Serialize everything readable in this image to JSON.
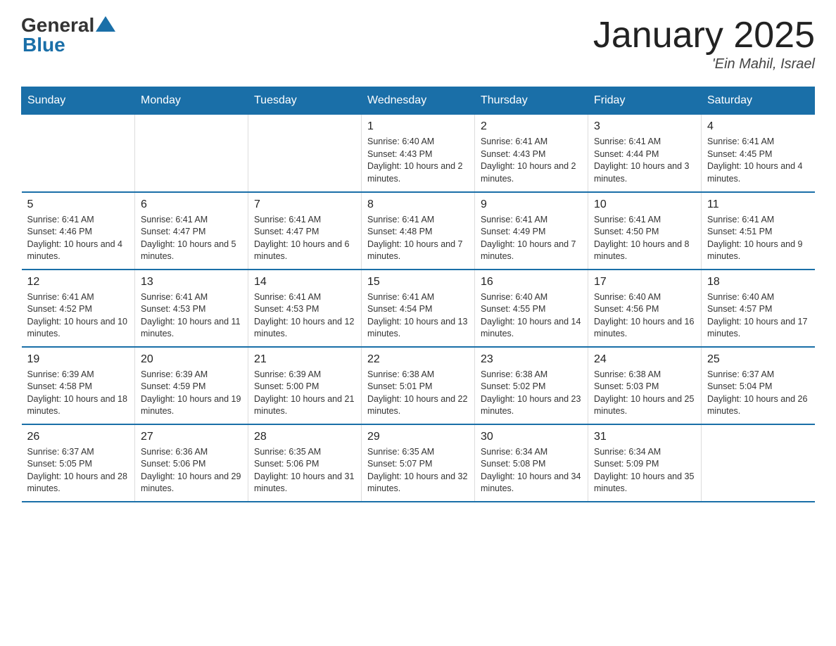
{
  "header": {
    "logo_general": "General",
    "logo_blue": "Blue",
    "title": "January 2025",
    "subtitle": "'Ein Mahil, Israel"
  },
  "days_of_week": [
    "Sunday",
    "Monday",
    "Tuesday",
    "Wednesday",
    "Thursday",
    "Friday",
    "Saturday"
  ],
  "weeks": [
    [
      {
        "day": "",
        "info": ""
      },
      {
        "day": "",
        "info": ""
      },
      {
        "day": "",
        "info": ""
      },
      {
        "day": "1",
        "info": "Sunrise: 6:40 AM\nSunset: 4:43 PM\nDaylight: 10 hours and 2 minutes."
      },
      {
        "day": "2",
        "info": "Sunrise: 6:41 AM\nSunset: 4:43 PM\nDaylight: 10 hours and 2 minutes."
      },
      {
        "day": "3",
        "info": "Sunrise: 6:41 AM\nSunset: 4:44 PM\nDaylight: 10 hours and 3 minutes."
      },
      {
        "day": "4",
        "info": "Sunrise: 6:41 AM\nSunset: 4:45 PM\nDaylight: 10 hours and 4 minutes."
      }
    ],
    [
      {
        "day": "5",
        "info": "Sunrise: 6:41 AM\nSunset: 4:46 PM\nDaylight: 10 hours and 4 minutes."
      },
      {
        "day": "6",
        "info": "Sunrise: 6:41 AM\nSunset: 4:47 PM\nDaylight: 10 hours and 5 minutes."
      },
      {
        "day": "7",
        "info": "Sunrise: 6:41 AM\nSunset: 4:47 PM\nDaylight: 10 hours and 6 minutes."
      },
      {
        "day": "8",
        "info": "Sunrise: 6:41 AM\nSunset: 4:48 PM\nDaylight: 10 hours and 7 minutes."
      },
      {
        "day": "9",
        "info": "Sunrise: 6:41 AM\nSunset: 4:49 PM\nDaylight: 10 hours and 7 minutes."
      },
      {
        "day": "10",
        "info": "Sunrise: 6:41 AM\nSunset: 4:50 PM\nDaylight: 10 hours and 8 minutes."
      },
      {
        "day": "11",
        "info": "Sunrise: 6:41 AM\nSunset: 4:51 PM\nDaylight: 10 hours and 9 minutes."
      }
    ],
    [
      {
        "day": "12",
        "info": "Sunrise: 6:41 AM\nSunset: 4:52 PM\nDaylight: 10 hours and 10 minutes."
      },
      {
        "day": "13",
        "info": "Sunrise: 6:41 AM\nSunset: 4:53 PM\nDaylight: 10 hours and 11 minutes."
      },
      {
        "day": "14",
        "info": "Sunrise: 6:41 AM\nSunset: 4:53 PM\nDaylight: 10 hours and 12 minutes."
      },
      {
        "day": "15",
        "info": "Sunrise: 6:41 AM\nSunset: 4:54 PM\nDaylight: 10 hours and 13 minutes."
      },
      {
        "day": "16",
        "info": "Sunrise: 6:40 AM\nSunset: 4:55 PM\nDaylight: 10 hours and 14 minutes."
      },
      {
        "day": "17",
        "info": "Sunrise: 6:40 AM\nSunset: 4:56 PM\nDaylight: 10 hours and 16 minutes."
      },
      {
        "day": "18",
        "info": "Sunrise: 6:40 AM\nSunset: 4:57 PM\nDaylight: 10 hours and 17 minutes."
      }
    ],
    [
      {
        "day": "19",
        "info": "Sunrise: 6:39 AM\nSunset: 4:58 PM\nDaylight: 10 hours and 18 minutes."
      },
      {
        "day": "20",
        "info": "Sunrise: 6:39 AM\nSunset: 4:59 PM\nDaylight: 10 hours and 19 minutes."
      },
      {
        "day": "21",
        "info": "Sunrise: 6:39 AM\nSunset: 5:00 PM\nDaylight: 10 hours and 21 minutes."
      },
      {
        "day": "22",
        "info": "Sunrise: 6:38 AM\nSunset: 5:01 PM\nDaylight: 10 hours and 22 minutes."
      },
      {
        "day": "23",
        "info": "Sunrise: 6:38 AM\nSunset: 5:02 PM\nDaylight: 10 hours and 23 minutes."
      },
      {
        "day": "24",
        "info": "Sunrise: 6:38 AM\nSunset: 5:03 PM\nDaylight: 10 hours and 25 minutes."
      },
      {
        "day": "25",
        "info": "Sunrise: 6:37 AM\nSunset: 5:04 PM\nDaylight: 10 hours and 26 minutes."
      }
    ],
    [
      {
        "day": "26",
        "info": "Sunrise: 6:37 AM\nSunset: 5:05 PM\nDaylight: 10 hours and 28 minutes."
      },
      {
        "day": "27",
        "info": "Sunrise: 6:36 AM\nSunset: 5:06 PM\nDaylight: 10 hours and 29 minutes."
      },
      {
        "day": "28",
        "info": "Sunrise: 6:35 AM\nSunset: 5:06 PM\nDaylight: 10 hours and 31 minutes."
      },
      {
        "day": "29",
        "info": "Sunrise: 6:35 AM\nSunset: 5:07 PM\nDaylight: 10 hours and 32 minutes."
      },
      {
        "day": "30",
        "info": "Sunrise: 6:34 AM\nSunset: 5:08 PM\nDaylight: 10 hours and 34 minutes."
      },
      {
        "day": "31",
        "info": "Sunrise: 6:34 AM\nSunset: 5:09 PM\nDaylight: 10 hours and 35 minutes."
      },
      {
        "day": "",
        "info": ""
      }
    ]
  ]
}
